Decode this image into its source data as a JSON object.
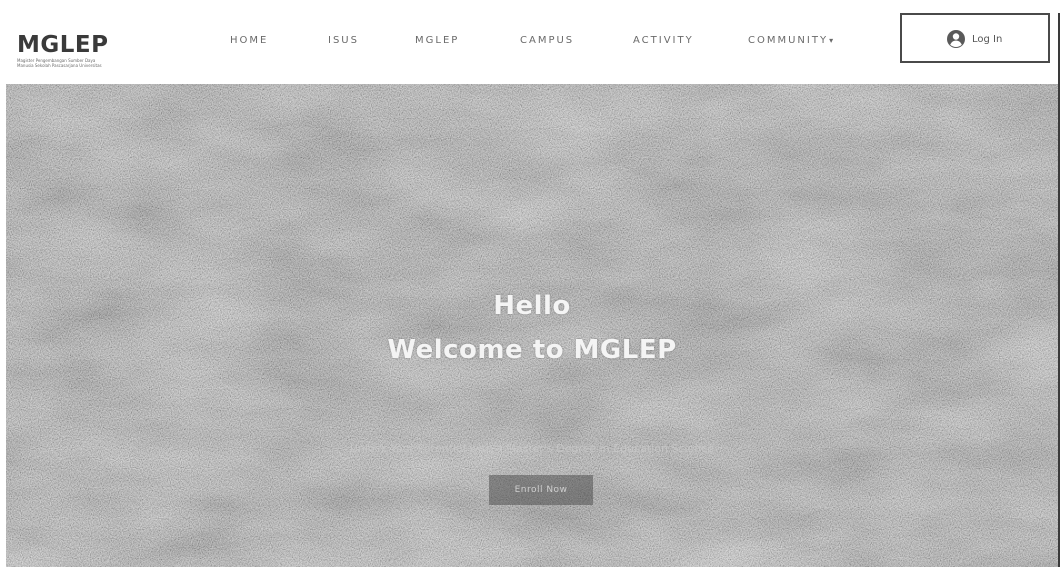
{
  "header": {
    "logo": {
      "title": "MGLEP",
      "tagline": "Magister Pengembangan Sumber Daya Manusia Sekolah Pascasarjana Universitas"
    },
    "nav": [
      {
        "label": "HOME",
        "has_dropdown": false
      },
      {
        "label": "ISUS",
        "has_dropdown": false
      },
      {
        "label": "MGLEP",
        "has_dropdown": false
      },
      {
        "label": "CAMPUS",
        "has_dropdown": false
      },
      {
        "label": "ACTIVITY",
        "has_dropdown": false
      },
      {
        "label": "COMMUNITY",
        "has_dropdown": true
      }
    ],
    "login": {
      "label": "Log In",
      "icon": "user-avatar-icon"
    }
  },
  "hero": {
    "title_line1": "Hello",
    "title_line2": "Welcome to MGLEP",
    "subtitle": "Unlock Your Potential with a Master's Degree in Education Science",
    "button_label": "Enroll Now"
  },
  "colors": {
    "header_bg": "#ffffff",
    "nav_text": "#6a6a6a",
    "logo_text": "#3a3a3a",
    "hero_text": "#f4f4f4",
    "login_border": "#4a4a4a"
  }
}
